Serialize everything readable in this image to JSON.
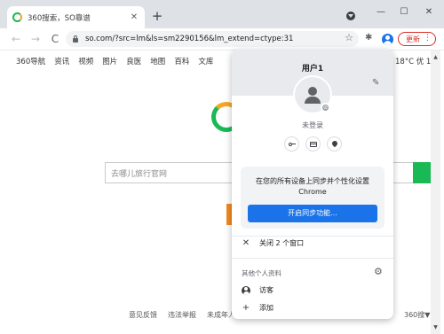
{
  "tab": {
    "title": "360搜索，SO靠谱",
    "close": "✕"
  },
  "new_tab": "+",
  "window_controls": {
    "minimize": "—",
    "maximize": "☐",
    "close": "✕"
  },
  "toolbar": {
    "back": "←",
    "forward": "→",
    "reload": "C",
    "url": "so.com/?src=lm&ls=sm2290156&lm_extend=ctype:31",
    "bookmark": "☆",
    "extensions": "✱",
    "update_label": "更新",
    "update_menu": "⋮"
  },
  "page": {
    "nav_links": [
      "360导航",
      "资讯",
      "视频",
      "图片",
      "良医",
      "地图",
      "百科",
      "文库"
    ],
    "weather": "18°C 优 1",
    "search_placeholder": "去哪儿旅行官网",
    "footer_links": [
      "意见反馈",
      "违法举报",
      "未成年人"
    ],
    "footer_right": "360搜▼"
  },
  "popup": {
    "profile_name": "用户1",
    "status": "未登录",
    "sync_prompt_line1": "在您的所有设备上同步并个性化设置",
    "sync_prompt_line2": "Chrome",
    "sync_button": "开启同步功能...",
    "close_windows": "关闭 2 个窗口",
    "other_profiles": "其他个人资料",
    "guest": "访客",
    "add": "添加"
  },
  "colors": {
    "accent": "#1a73e8",
    "update": "#d93025",
    "brand_green": "#19b955",
    "brand_orange": "#f5a623"
  }
}
